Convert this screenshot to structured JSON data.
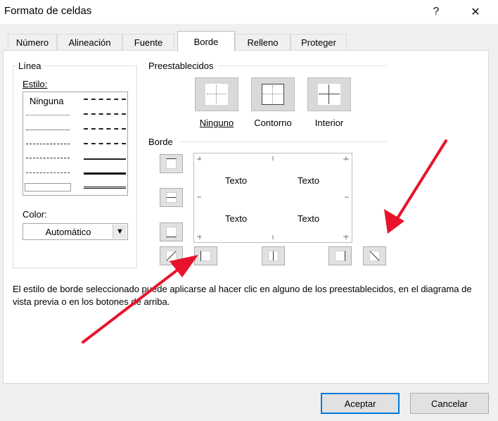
{
  "window": {
    "title": "Formato de celdas",
    "help_glyph": "?",
    "close_glyph": "✕"
  },
  "tabs": [
    {
      "label": "Número"
    },
    {
      "label": "Alineación"
    },
    {
      "label": "Fuente"
    },
    {
      "label": "Borde"
    },
    {
      "label": "Relleno"
    },
    {
      "label": "Proteger"
    }
  ],
  "active_tab": "Borde",
  "linea": {
    "title": "Línea",
    "estilo_label": "Estilo:",
    "none_style": "Ninguna",
    "color_label": "Color:",
    "color_value": "Automático"
  },
  "preestablecidos": {
    "title": "Preestablecidos",
    "items": [
      {
        "label": "Ninguno",
        "icon": "preset-none-icon"
      },
      {
        "label": "Contorno",
        "icon": "preset-outline-icon"
      },
      {
        "label": "Interior",
        "icon": "preset-inside-icon"
      }
    ]
  },
  "borde": {
    "title": "Borde",
    "preview_texts": [
      "Texto",
      "Texto",
      "Texto",
      "Texto"
    ]
  },
  "description": "El estilo de borde seleccionado puede aplicarse al hacer clic en alguno de los preestablecidos, en el diagrama de vista previa o en los botones de arriba.",
  "footer": {
    "ok": "Aceptar",
    "cancel": "Cancelar"
  },
  "colors": {
    "accent": "#0078d7",
    "arrow": "#e8132b"
  }
}
